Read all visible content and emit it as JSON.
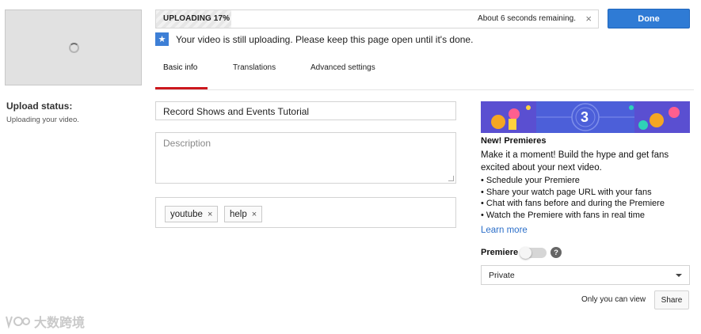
{
  "left": {
    "upload_status_label": "Upload status:",
    "upload_status_text": "Uploading your video."
  },
  "progress": {
    "label": "UPLOADING 17%",
    "percent": 17,
    "remaining": "About 6 seconds remaining.",
    "close_glyph": "×"
  },
  "done_label": "Done",
  "notice": {
    "icon": "star-icon",
    "icon_glyph": "★",
    "text": "Your video is still uploading. Please keep this page open until it's done."
  },
  "tabs": [
    {
      "label": "Basic info",
      "active": true
    },
    {
      "label": "Translations",
      "active": false
    },
    {
      "label": "Advanced settings",
      "active": false
    }
  ],
  "form": {
    "title_value": "Record Shows and Events Tutorial",
    "description_placeholder": "Description",
    "tags": [
      {
        "label": "youtube",
        "remove_glyph": "×"
      },
      {
        "label": "help",
        "remove_glyph": "×"
      }
    ]
  },
  "promo": {
    "banner_number": "3",
    "title": "New! Premieres",
    "description": "Make it a moment! Build the hype and get fans excited about your next video.",
    "bullets": [
      "Schedule your Premiere",
      "Share your watch page URL with your fans",
      "Chat with fans before and during the Premiere",
      "Watch the Premiere with fans in real time"
    ],
    "learn_more": "Learn more"
  },
  "premiere": {
    "label": "Premiere",
    "toggle_on": false,
    "help_glyph": "?"
  },
  "privacy": {
    "selected": "Private",
    "visibility_note": "Only you can view",
    "share_label": "Share"
  },
  "watermark": {
    "text": "大数跨境"
  },
  "colors": {
    "accent_blue": "#2f7bd5",
    "tab_underline_red": "#cc181e",
    "link_blue": "#2c6fc9",
    "banner_blue": "#4c5fd9"
  }
}
